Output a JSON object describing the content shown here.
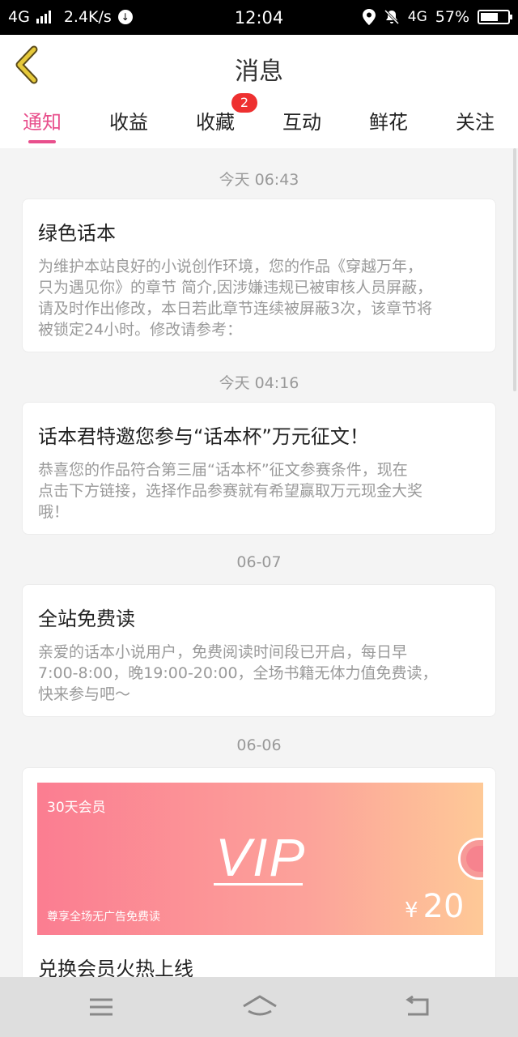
{
  "status_bar": {
    "network": "4G",
    "speed": "2.4K/s",
    "time": "12:04",
    "network_right": "4G",
    "battery": "57%",
    "battery_level": 0.57
  },
  "header": {
    "title": "消息"
  },
  "tabs": [
    {
      "label": "通知",
      "active": true
    },
    {
      "label": "收益"
    },
    {
      "label": "收藏",
      "badge": "2"
    },
    {
      "label": "互动"
    },
    {
      "label": "鲜花"
    },
    {
      "label": "关注"
    }
  ],
  "messages": [
    {
      "date": "今天 06:43",
      "title": "绿色话本",
      "body_lines": [
        "为维护本站良好的小说创作环境，您的作品《穿越万年，",
        "只为遇见你》的章节 简介,因涉嫌违规已被审核人员屏蔽，",
        "请及时作出修改，本日若此章节连续被屏蔽3次，该章节将",
        "被锁定24小时。修改请参考："
      ]
    },
    {
      "date": "今天 04:16",
      "title": "话本君特邀您参与“话本杯”万元征文！",
      "body_lines": [
        "恭喜您的作品符合第三届“话本杯”征文参赛条件，现在",
        "点击下方链接，选择作品参赛就有希望赢取万元现金大奖",
        "哦！"
      ]
    },
    {
      "date": "06-07",
      "title": "全站免费读",
      "body_lines": [
        "亲爱的话本小说用户，免费阅读时间段已开启，每日早",
        "7:00-8:00，晚19:00-20:00，全场书籍无体力值免费读，",
        "快来参与吧～"
      ]
    },
    {
      "date": "06-06",
      "title": "兑换会员火热上线",
      "banner": {
        "label": "30天会员",
        "big_text": "VIP",
        "subtitle": "尊享全场无广告免费读",
        "currency": "¥",
        "price": "20"
      }
    }
  ],
  "colors": {
    "accent": "#e84f8c",
    "badge": "#ee3030",
    "back_arrow": "#e6c93a"
  },
  "icons": {
    "back": "chevron-left-icon",
    "menu": "menu-icon",
    "home": "home-icon",
    "back_nav": "return-icon"
  }
}
